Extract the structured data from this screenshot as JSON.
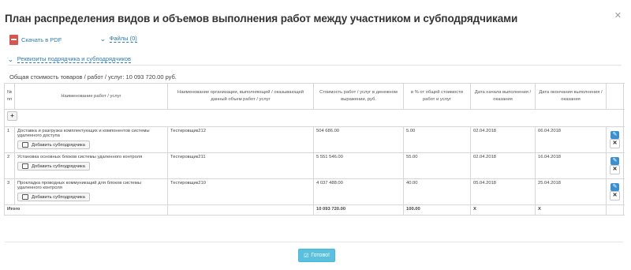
{
  "title": "План распределения видов и объемов выполнения работ между участником и субподрядчиками",
  "links": {
    "pdf": "Скачать в PDF",
    "files": "Файлы (0)",
    "requisites": "Реквизиты подрядчика и субподрядчиков"
  },
  "total_cost_text": "Общая стоимость товаров / работ / услуг: 10 093 720.00 руб.",
  "table": {
    "headers": [
      "№ пп",
      "Наименование работ / услуг",
      "Наименование организации, выполняющей / оказывающей данный объем работ / услуг",
      "Стоимость работ / услуг в денежном выражении, руб.",
      "в % от общей стоимости работ и услуг",
      "Дата начала выполнения / оказания",
      "Дата окончания выполнения / оказания"
    ],
    "add_subcontractor_label": "Добавить субподрядчика",
    "rows": [
      {
        "num": "1",
        "work": "Доставка и разгрузка комплектующих и компонентов системы удаленного доступа",
        "org": "Тестировщик212",
        "cost": "504 686.00",
        "percent": "5.00",
        "start": "02.04.2018",
        "end": "06.04.2018"
      },
      {
        "num": "2",
        "work": "Установка основных блоков системы удаленного контроля",
        "org": "Тестировщик211",
        "cost": "5 551 546.00",
        "percent": "55.00",
        "start": "02.04.2018",
        "end": "16.04.2018"
      },
      {
        "num": "3",
        "work": "Прокладка проводных коммуникаций для блоков системы удаленного контроля",
        "org": "Тестировщик210",
        "cost": "4 037 488.00",
        "percent": "40.00",
        "start": "05.04.2018",
        "end": "25.04.2018"
      }
    ],
    "totals": {
      "label": "Итого",
      "cost": "10 093 720.00",
      "percent": "100.00",
      "start": "X",
      "end": "X"
    }
  },
  "ok_button": "Готово!",
  "icons": {
    "close": "close-icon",
    "pdf": "pdf-icon",
    "edit": "pencil-icon",
    "delete": "x-icon"
  }
}
